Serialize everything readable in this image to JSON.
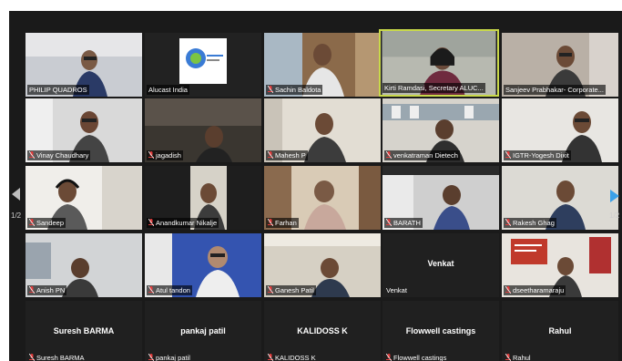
{
  "gallery": {
    "page_left": "1/2",
    "page_right": "1/2",
    "tiles": [
      {
        "label": "PHILIP QUADROS",
        "muted": false
      },
      {
        "label": "Alucast India",
        "muted": false
      },
      {
        "label": "Sachin Baldota",
        "muted": true
      },
      {
        "label": "Kirti Ramdasi, Secretary ALUC...",
        "muted": false,
        "active": true
      },
      {
        "label": "Sanjeev Prabhakar- Corporate...",
        "muted": false
      },
      {
        "label": "Vinay Chaudhary",
        "muted": true
      },
      {
        "label": "jagadish",
        "muted": true
      },
      {
        "label": "Mahesh P",
        "muted": true
      },
      {
        "label": "venkatraman Dietech",
        "muted": true
      },
      {
        "label": "IGTR-Yogesh Dixit",
        "muted": true
      },
      {
        "label": "Sandeep",
        "muted": true
      },
      {
        "label": "Anandkumar Nikalje",
        "muted": true
      },
      {
        "label": "Farhan",
        "muted": true
      },
      {
        "label": "BARATH",
        "muted": true
      },
      {
        "label": "Rakesh Ghag",
        "muted": true
      },
      {
        "label": "Anish PN",
        "muted": true
      },
      {
        "label": "Atul tandon",
        "muted": true
      },
      {
        "label": "Ganesh Patil",
        "muted": true
      },
      {
        "label": "Venkat",
        "muted": false,
        "center_name": "Venkat"
      },
      {
        "label": "dseetharamaraju",
        "muted": true
      },
      {
        "label": "Suresh BARMA",
        "muted": true,
        "center_name": "Suresh BARMA"
      },
      {
        "label": "pankaj patil",
        "muted": true,
        "center_name": "pankaj patil"
      },
      {
        "label": "KALIDOSS K",
        "muted": true,
        "center_name": "KALIDOSS K"
      },
      {
        "label": "Flowwell castings",
        "muted": true,
        "center_name": "Flowwell castings"
      },
      {
        "label": "Rahul",
        "muted": true,
        "center_name": "Rahul"
      }
    ]
  },
  "colors": {
    "active_border": "#c9d94a",
    "nav_arrow_right": "#3aa0e8",
    "muted_mic": "#e23b3b"
  }
}
